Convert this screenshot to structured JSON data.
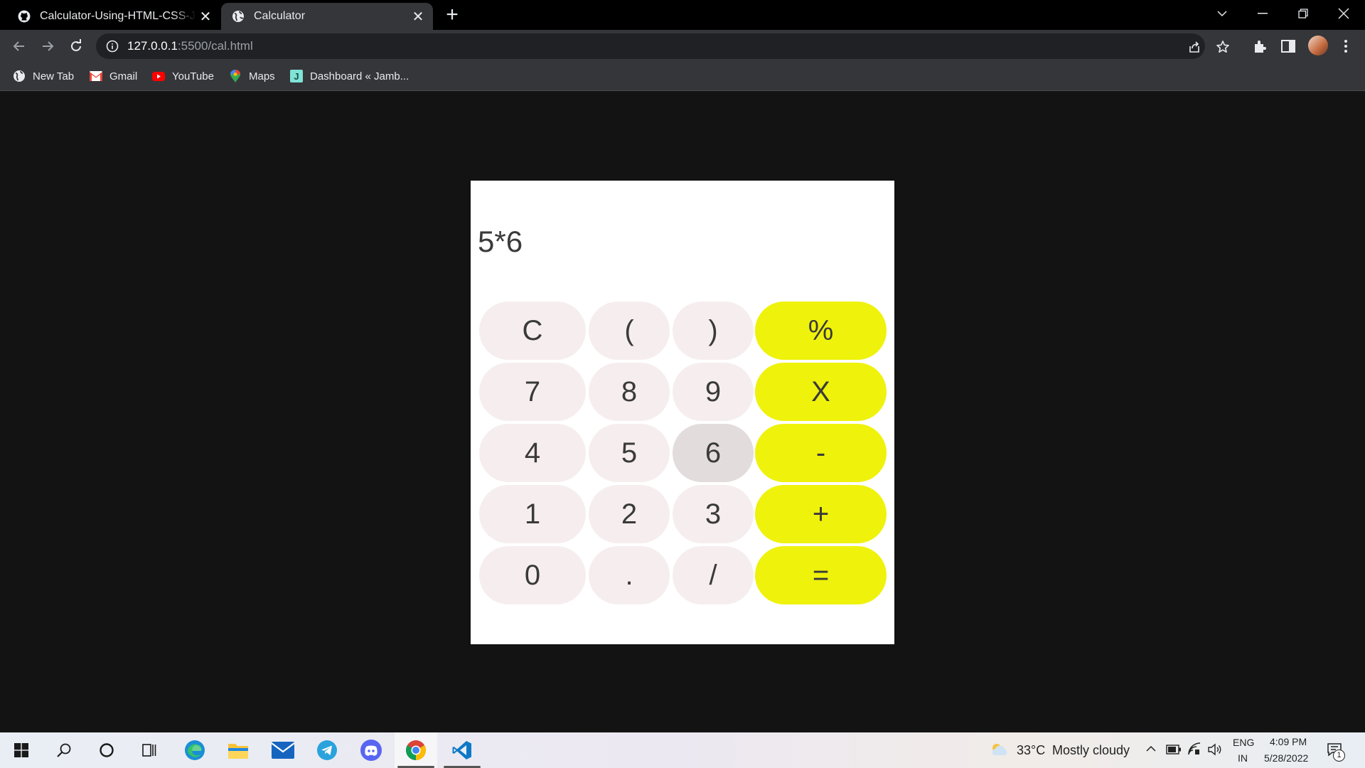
{
  "browser": {
    "tabs": [
      {
        "title": "Calculator-Using-HTML-CSS-JS/cal.html",
        "icon": "github-icon"
      },
      {
        "title": "Calculator",
        "icon": "globe-icon",
        "active": true
      }
    ],
    "address": {
      "host": "127.0.0.1",
      "path": ":5500/cal.html"
    },
    "bookmarks": [
      {
        "label": "New Tab",
        "icon": "globe-icon"
      },
      {
        "label": "Gmail",
        "icon": "gmail-icon"
      },
      {
        "label": "YouTube",
        "icon": "youtube-icon"
      },
      {
        "label": "Maps",
        "icon": "maps-icon"
      },
      {
        "label": "Dashboard « Jamb...",
        "icon": "j-icon"
      }
    ]
  },
  "calculator": {
    "display": "5*6",
    "keys": [
      [
        "C",
        "(",
        ")",
        "%"
      ],
      [
        "7",
        "8",
        "9",
        "X"
      ],
      [
        "4",
        "5",
        "6",
        "-"
      ],
      [
        "1",
        "2",
        "3",
        "+"
      ],
      [
        "0",
        ".",
        "/",
        "="
      ]
    ],
    "pressed_key": "6"
  },
  "taskbar": {
    "weather": {
      "temp": "33°C",
      "condition": "Mostly cloudy"
    },
    "language": {
      "lang": "ENG",
      "region": "IN"
    },
    "clock": {
      "time": "4:09 PM",
      "date": "5/28/2022"
    },
    "notifications": "1"
  },
  "colors": {
    "operator_key": "#eff20b",
    "digit_key": "#f6eeee",
    "page_bg": "#131313"
  }
}
